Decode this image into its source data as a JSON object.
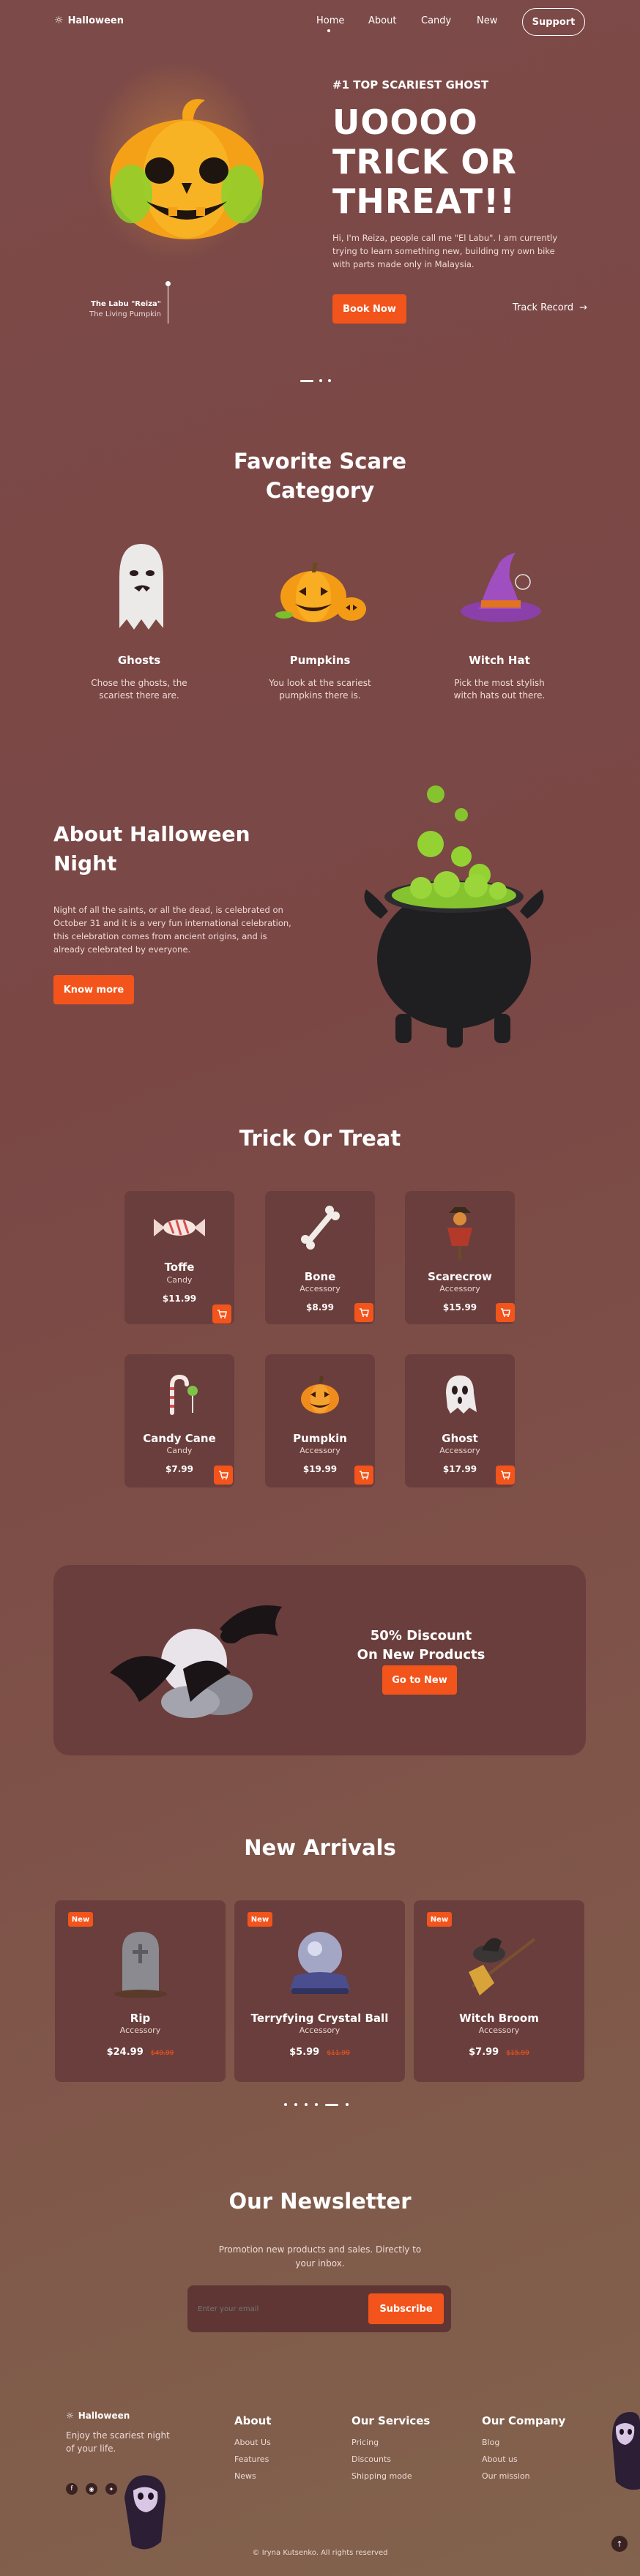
{
  "header": {
    "logo_text": "Halloween",
    "nav": [
      "Home",
      "About",
      "Candy",
      "New"
    ],
    "support_label": "Support"
  },
  "hero": {
    "tag": "#1 TOP SCARIEST GHOST",
    "title_line1": "UOOOO",
    "title_line2": "TRICK OR",
    "title_line3": "THREAT!!",
    "description": "Hi, I'm Reiza, people call me \"El Labu\". I am currently trying to learn something new, building my own bike with parts made only in Malaysia.",
    "book_label": "Book Now",
    "track_label": "Track Record",
    "caption_name": "The Labu \"Reiza\"",
    "caption_sub": "The Living Pumpkin"
  },
  "categories": {
    "title_line1": "Favorite Scare",
    "title_line2": "Category",
    "items": [
      {
        "name": "Ghosts",
        "desc_line1": "Chose the ghosts, the",
        "desc_line2": "scariest there are."
      },
      {
        "name": "Pumpkins",
        "desc_line1": "You look at the scariest",
        "desc_line2": "pumpkins there is."
      },
      {
        "name": "Witch Hat",
        "desc_line1": "Pick the most stylish",
        "desc_line2": "witch hats out there."
      }
    ]
  },
  "about": {
    "title_line1": "About Halloween",
    "title_line2": "Night",
    "text_line1": "Night of all the saints, or all the dead, is celebrated on",
    "text_line2": "October 31 and it is a very fun international celebration,",
    "text_line3": "this celebration comes from ancient origins, and is",
    "text_line4": "already celebrated by everyone.",
    "button_label": "Know more"
  },
  "trick": {
    "title": "Trick Or Treat",
    "products": [
      {
        "name": "Toffe",
        "type": "Candy",
        "price": "$11.99"
      },
      {
        "name": "Bone",
        "type": "Accessory",
        "price": "$8.99"
      },
      {
        "name": "Scarecrow",
        "type": "Accessory",
        "price": "$15.99"
      },
      {
        "name": "Candy Cane",
        "type": "Candy",
        "price": "$7.99"
      },
      {
        "name": "Pumpkin",
        "type": "Accessory",
        "price": "$19.99"
      },
      {
        "name": "Ghost",
        "type": "Accessory",
        "price": "$17.99"
      }
    ]
  },
  "promo": {
    "line1": "50% Discount",
    "line2": "On New Products",
    "button_label": "Go to New"
  },
  "arrivals": {
    "title": "New Arrivals",
    "badge": "New",
    "items": [
      {
        "name": "Rip",
        "type": "Accessory",
        "price": "$24.99",
        "old_price": "$49.99"
      },
      {
        "name": "Terryfying Crystal Ball",
        "type": "Accessory",
        "price": "$5.99",
        "old_price": "$11.99"
      },
      {
        "name": "Witch Broom",
        "type": "Accessory",
        "price": "$7.99",
        "old_price": "$15.99"
      }
    ]
  },
  "newsletter": {
    "title": "Our Newsletter",
    "text_line1": "Promotion new products and sales. Directly to",
    "text_line2": "your inbox.",
    "placeholder": "Enter your email",
    "button_label": "Subscribe"
  },
  "footer": {
    "logo_text": "Halloween",
    "tagline_line1": "Enjoy the scariest night",
    "tagline_line2": "of your life.",
    "columns": [
      {
        "title": "About",
        "links": [
          "About Us",
          "Features",
          "News"
        ]
      },
      {
        "title": "Our Services",
        "links": [
          "Pricing",
          "Discounts",
          "Shipping mode"
        ]
      },
      {
        "title": "Our Company",
        "links": [
          "Blog",
          "About us",
          "Our mission"
        ]
      }
    ],
    "copyright": "© Iryna Kutsenko. All rights reserved"
  },
  "colors": {
    "accent": "#f2541b",
    "background": "#7c4a48",
    "card": "#6a3e3c"
  }
}
